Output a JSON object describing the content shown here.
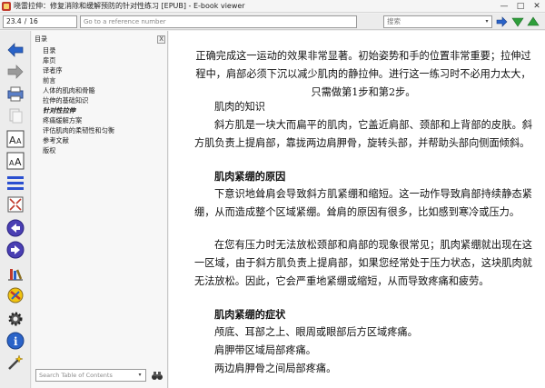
{
  "window": {
    "title": "晓雷拉伸：修复消除和缓解预防的针对性练习 [EPUB] - E-book viewer",
    "minimize_label": "—",
    "maximize_label": "□",
    "close_label": "✕"
  },
  "toolbar": {
    "page_current": "23.4",
    "page_separator": "/",
    "page_total": "16",
    "goto_placeholder": "Go to a reference number",
    "search_placeholder": "搜索"
  },
  "sidebar_icons": [
    "back-arrow-icon",
    "forward-arrow-icon",
    "print-icon",
    "copy-icon",
    "font-larger-icon",
    "font-smaller-icon",
    "toc-lines-icon",
    "fullscreen-icon",
    "previous-page-icon",
    "next-page-icon",
    "library-icon",
    "bookmark-icon",
    "preferences-gear-icon",
    "info-icon",
    "wand-icon"
  ],
  "toc": {
    "title": "目录",
    "close_label": "X",
    "items": [
      {
        "label": "目录",
        "current": false
      },
      {
        "label": "扉页",
        "current": false
      },
      {
        "label": "译者序",
        "current": false
      },
      {
        "label": "前言",
        "current": false
      },
      {
        "label": "人体的肌肉和骨骼",
        "current": false
      },
      {
        "label": "拉伸的基础知识",
        "current": false
      },
      {
        "label": "针对性拉伸",
        "current": true
      },
      {
        "label": "疼痛缓解方案",
        "current": false
      },
      {
        "label": "评估肌肉的柔韧性和匀衡",
        "current": false
      },
      {
        "label": "参考文献",
        "current": false
      },
      {
        "label": "版权",
        "current": false
      }
    ],
    "search_placeholder": "Search Table of Contents"
  },
  "content": {
    "p1": "正确完成这一运动的效果非常显著。初始姿势和手的位置非常重要；拉伸过程中，肩部必须下沉以减少肌肉的静拉伸。进行这一练习时不必用力太大，只需做第1步和第2步。",
    "p2": "肌肉的知识",
    "p3": "斜方肌是一块大而扁平的肌肉，它盖近肩部、颈部和上背部的皮肤。斜方肌负责上提肩部，靠拢两边肩胛骨，旋转头部，并帮助头部向侧面倾斜。",
    "h1": "肌肉紧绷的原因",
    "p4": "下意识地耸肩会导致斜方肌紧绷和缩短。这一动作导致肩部持续静态紧绷，从而造成整个区域紧绷。耸肩的原因有很多，比如感到寒冷或压力。",
    "p5": "在您有压力时无法放松颈部和肩部的现象很常见；肌肉紧绷就出现在这一区域，由于斜方肌负责上提肩部，如果您经常处于压力状态，这块肌肉就无法放松。因此，它会严重地紧绷或缩短，从而导致疼痛和疲劳。",
    "h2": "肌肉紧绷的症状",
    "s1": "颅底、耳部之上、眼周或眼部后方区域疼痛。",
    "s2": "肩胛带区域局部疼痛。",
    "s3": "两边肩胛骨之间局部疼痛。"
  },
  "colors": {
    "arrow_blue": "#2a63c8",
    "arrow_grey": "#8a8a8a",
    "nav_green": "#2e9e3a",
    "nav_circle": "#4a3fb3"
  }
}
